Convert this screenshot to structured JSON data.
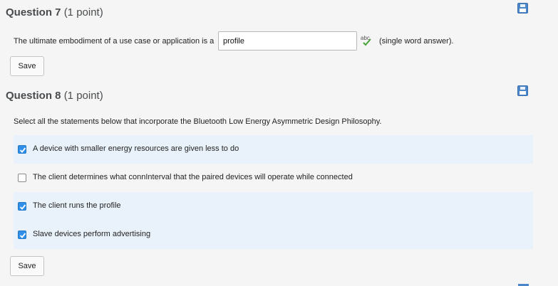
{
  "q7": {
    "title": "Question 7",
    "points": "(1 point)",
    "prompt": "The ultimate embodiment of a use case or application is a",
    "answer_value": "profile",
    "hint": "(single word answer).",
    "save_label": "Save",
    "spellcheck_glyph": "abc"
  },
  "q8": {
    "title": "Question 8",
    "points": "(1 point)",
    "prompt": "Select all the statements below that incorporate the Bluetooth Low Energy Asymmetric Design Philosophy.",
    "options": [
      {
        "label": "A device with smaller energy resources are given less to do",
        "checked": true
      },
      {
        "label": "The client determines what connInterval that the paired devices will operate while connected",
        "checked": false
      },
      {
        "label": "The client runs the profile",
        "checked": true
      },
      {
        "label": "Slave devices perform advertising",
        "checked": true
      }
    ],
    "save_label": "Save"
  },
  "colors": {
    "accent": "#2e8ee8",
    "selected_row": "#e9f2fb",
    "save_icon": "#4a86c8"
  },
  "icons": {
    "save": "floppy-disk-icon",
    "spellcheck": "spellcheck-icon",
    "checkbox": "checkbox"
  }
}
